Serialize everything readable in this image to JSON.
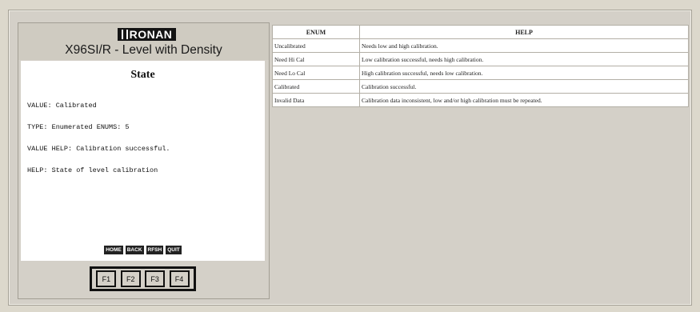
{
  "device": {
    "logo_text": "RONAN",
    "title": "X96SI/R - Level with Density"
  },
  "screen": {
    "title": "State",
    "lines": [
      "VALUE: Calibrated",
      "TYPE: Enumerated ENUMS: 5",
      "VALUE HELP: Calibration successful.",
      "HELP: State of level calibration"
    ],
    "softkeys": [
      "HOME",
      "BACK",
      "RFSH",
      "QUIT"
    ]
  },
  "function_keys": [
    "F1",
    "F2",
    "F3",
    "F4"
  ],
  "enum_table": {
    "headers": [
      "ENUM",
      "HELP"
    ],
    "rows": [
      {
        "enum": "Uncalibrated",
        "help": "Needs low and high calibration."
      },
      {
        "enum": "Need Hi Cal",
        "help": "Low calibration successful, needs high calibration."
      },
      {
        "enum": "Need Lo Cal",
        "help": "High calibration successful, needs low calibration."
      },
      {
        "enum": "Calibrated",
        "help": "Calibration successful."
      },
      {
        "enum": "Invalid Data",
        "help": "Calibration data inconsistent, low and/or high calibration must be repeated."
      }
    ]
  }
}
